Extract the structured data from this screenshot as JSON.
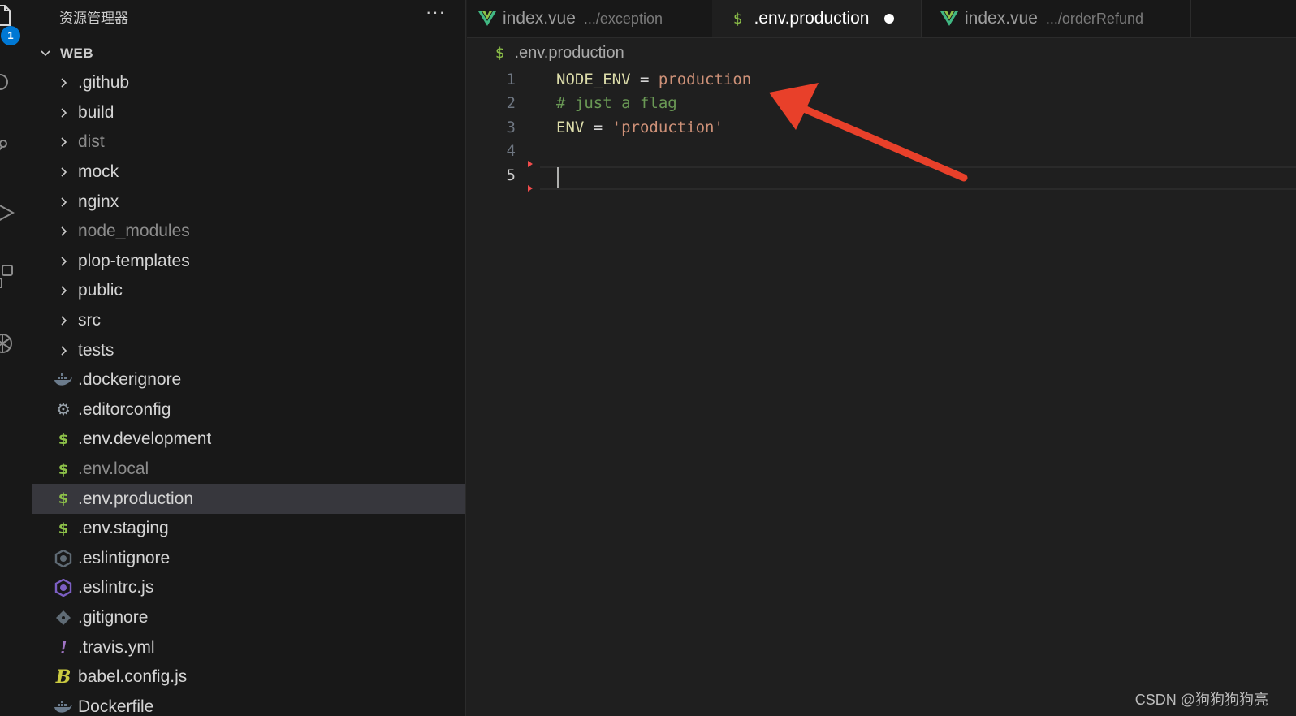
{
  "activity_bar": {
    "icons": [
      "files-icon",
      "search-icon",
      "source-control-icon",
      "run-debug-icon",
      "extensions-icon",
      "openai-icon"
    ],
    "explorer_badge": "1"
  },
  "sidebar": {
    "title": "资源管理器",
    "more_label": "···",
    "workspace": "WEB",
    "items": [
      {
        "label": ".github",
        "kind": "folder",
        "dim": false
      },
      {
        "label": "build",
        "kind": "folder",
        "dim": false
      },
      {
        "label": "dist",
        "kind": "folder",
        "dim": true
      },
      {
        "label": "mock",
        "kind": "folder",
        "dim": false
      },
      {
        "label": "nginx",
        "kind": "folder",
        "dim": false
      },
      {
        "label": "node_modules",
        "kind": "folder",
        "dim": true
      },
      {
        "label": "plop-templates",
        "kind": "folder",
        "dim": false
      },
      {
        "label": "public",
        "kind": "folder",
        "dim": false
      },
      {
        "label": "src",
        "kind": "folder",
        "dim": false
      },
      {
        "label": "tests",
        "kind": "folder",
        "dim": false
      },
      {
        "label": ".dockerignore",
        "kind": "file",
        "icon": "docker-icon",
        "dim": false
      },
      {
        "label": ".editorconfig",
        "kind": "file",
        "icon": "gear-icon",
        "dim": false
      },
      {
        "label": ".env.development",
        "kind": "file",
        "icon": "dollar-icon",
        "dim": false
      },
      {
        "label": ".env.local",
        "kind": "file",
        "icon": "dollar-icon",
        "dim": true
      },
      {
        "label": ".env.production",
        "kind": "file",
        "icon": "dollar-icon",
        "dim": false,
        "active": true
      },
      {
        "label": ".env.staging",
        "kind": "file",
        "icon": "dollar-icon",
        "dim": false
      },
      {
        "label": ".eslintignore",
        "kind": "file",
        "icon": "eslint-icon",
        "dim": false
      },
      {
        "label": ".eslintrc.js",
        "kind": "file",
        "icon": "eslint-icon",
        "dim": false
      },
      {
        "label": ".gitignore",
        "kind": "file",
        "icon": "git-icon",
        "dim": false
      },
      {
        "label": ".travis.yml",
        "kind": "file",
        "icon": "exclamation-icon",
        "dim": false
      },
      {
        "label": "babel.config.js",
        "kind": "file",
        "icon": "babel-icon",
        "dim": false
      },
      {
        "label": "Dockerfile",
        "kind": "file",
        "icon": "docker-icon",
        "dim": false
      }
    ]
  },
  "tabs": [
    {
      "name": "index.vue",
      "path": ".../exception",
      "icon": "vue-icon",
      "active": false
    },
    {
      "name": ".env.production",
      "icon": "dollar-icon",
      "active": true,
      "dirty": true
    },
    {
      "name": "index.vue",
      "path": ".../orderRefund",
      "icon": "vue-icon",
      "active": false
    }
  ],
  "breadcrumb": {
    "file": ".env.production"
  },
  "editor": {
    "current_line": 5,
    "lines": [
      {
        "num": "1",
        "key": "NODE_ENV",
        "op": " = ",
        "value": "production",
        "comment": ""
      },
      {
        "num": "2",
        "key": "",
        "op": "",
        "value": "",
        "comment": "# just a flag"
      },
      {
        "num": "3",
        "key": "ENV",
        "op": " = ",
        "value": "'production'",
        "comment": ""
      },
      {
        "num": "4",
        "key": "",
        "op": "",
        "value": "",
        "comment": ""
      },
      {
        "num": "5",
        "key": "",
        "op": "",
        "value": "",
        "comment": ""
      }
    ]
  },
  "annotation": {
    "arrow_color": "#e8402a"
  },
  "watermark": "CSDN @狗狗狗狗亮",
  "colors": {
    "accent": "#0078d4",
    "dollar": "#8dc149",
    "vue": "#41b883",
    "eslint": "#7c5fc4"
  }
}
